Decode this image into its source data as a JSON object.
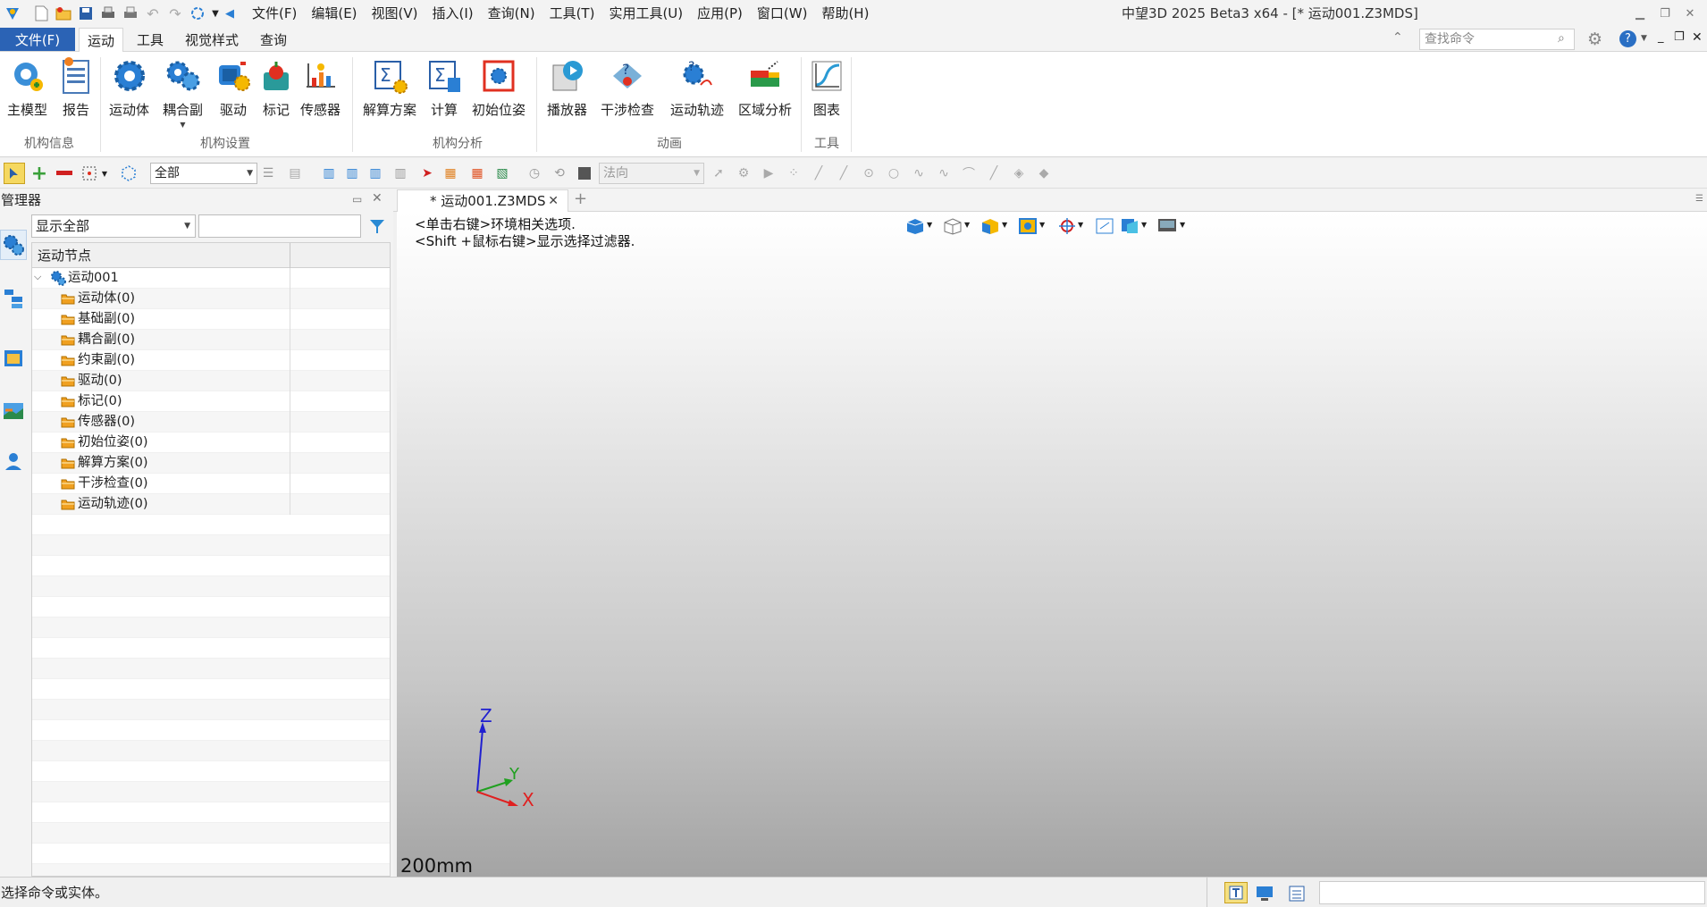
{
  "app": {
    "title": "中望3D 2025 Beta3 x64 - [* 运动001.Z3MDS]"
  },
  "menu": [
    "文件(F)",
    "编辑(E)",
    "视图(V)",
    "插入(I)",
    "查询(N)",
    "工具(T)",
    "实用工具(U)",
    "应用(P)",
    "窗口(W)",
    "帮助(H)"
  ],
  "ribbon_tabs": {
    "file": "文件(F)",
    "tabs": [
      "运动",
      "工具",
      "视觉样式",
      "查询"
    ],
    "active": "运动"
  },
  "search": {
    "placeholder": "查找命令"
  },
  "ribbon": {
    "groups": [
      {
        "label": "机构信息",
        "buttons": [
          "主模型",
          "报告"
        ]
      },
      {
        "label": "机构设置",
        "buttons": [
          "运动体",
          "耦合副",
          "驱动",
          "标记",
          "传感器"
        ]
      },
      {
        "label": "机构分析",
        "buttons": [
          "解算方案",
          "计算",
          "初始位姿"
        ]
      },
      {
        "label": "动画",
        "buttons": [
          "播放器",
          "干涉检查",
          "运动轨迹",
          "区域分析"
        ]
      },
      {
        "label": "工具",
        "buttons": [
          "图表"
        ]
      }
    ]
  },
  "toolbar": {
    "filter_value": "全部",
    "direction_value": "法向"
  },
  "manager": {
    "title": "管理器",
    "display_filter": "显示全部",
    "column_header": "运动节点",
    "root": "运动001",
    "nodes": [
      "运动体(0)",
      "基础副(0)",
      "耦合副(0)",
      "约束副(0)",
      "驱动(0)",
      "标记(0)",
      "传感器(0)",
      "初始位姿(0)",
      "解算方案(0)",
      "干涉检查(0)",
      "运动轨迹(0)"
    ]
  },
  "document": {
    "tab_label": "* 运动001.Z3MDS",
    "hint1": "<单击右键>环境相关选项.",
    "hint2": "<Shift +鼠标右键>显示选择过滤器.",
    "scale": "200mm",
    "axes": {
      "x": "X",
      "y": "Y",
      "z": "Z"
    }
  },
  "status": {
    "text": "选择命令或实体。"
  },
  "colors": {
    "file_tab": "#2b63b5",
    "axis_x": "#e02020",
    "axis_y": "#20a020",
    "axis_z": "#2020d0",
    "folder": "#f0a020"
  }
}
